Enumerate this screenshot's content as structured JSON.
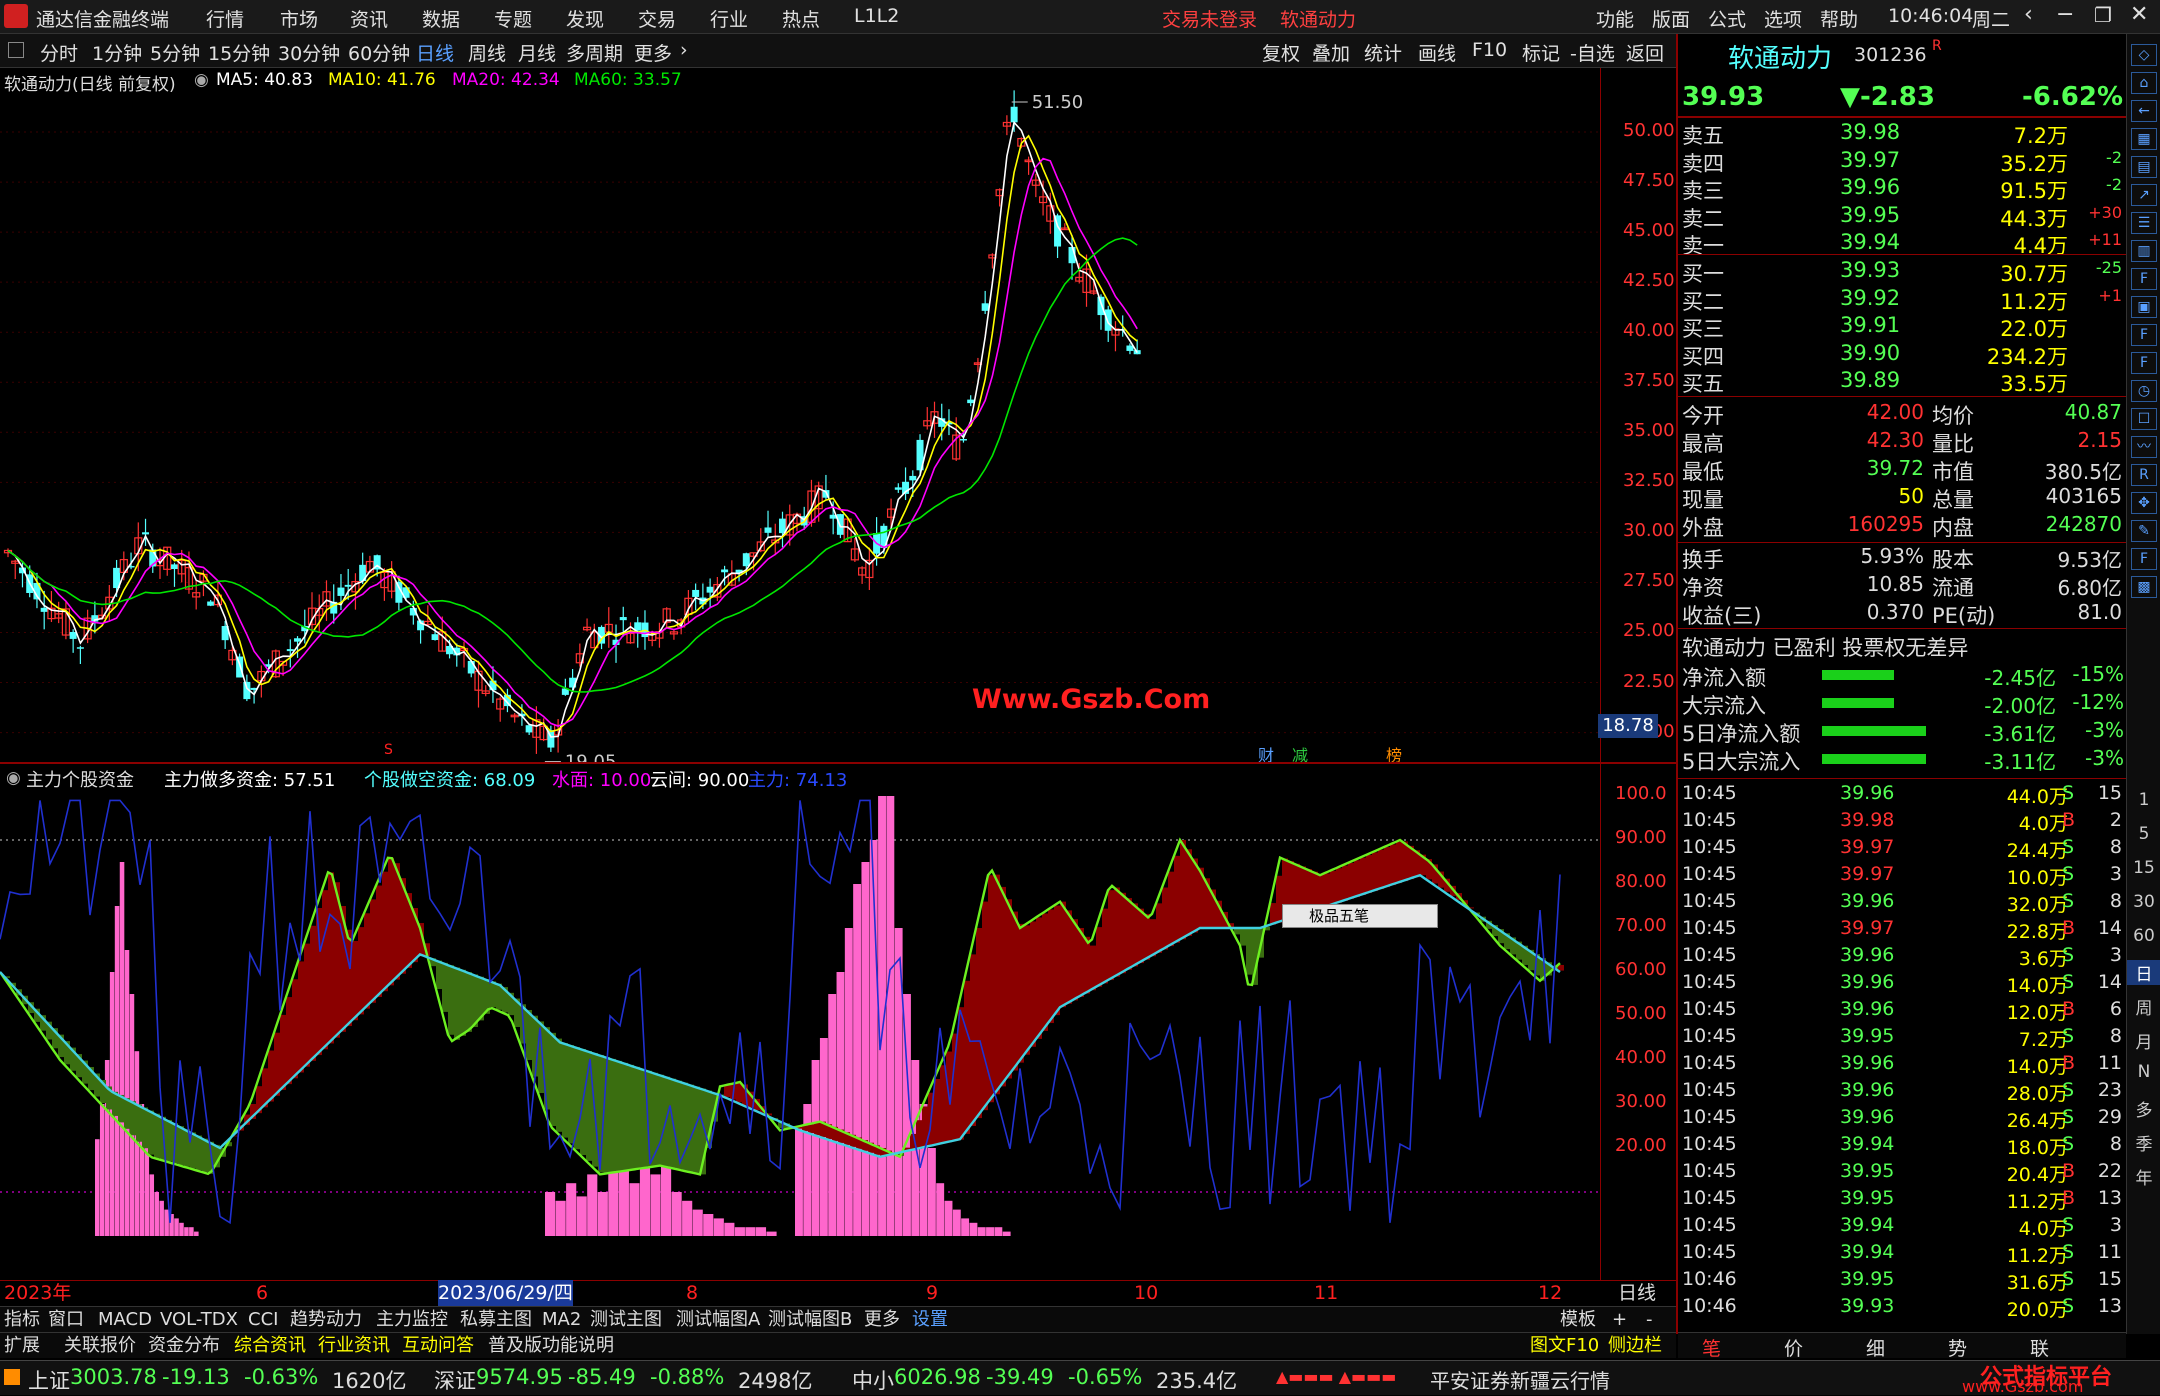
{
  "app": {
    "title": "通达信金融终端",
    "menus": [
      "行情",
      "市场",
      "资讯",
      "数据",
      "专题",
      "发现",
      "交易",
      "行业",
      "热点",
      "L1L2"
    ],
    "login": "交易未登录",
    "stock_title": "软通动力",
    "right_menus": [
      "功能",
      "版面",
      "公式",
      "选项",
      "帮助"
    ],
    "time": "10:46:04",
    "weekday": "周二"
  },
  "periods": {
    "items": [
      "分时",
      "1分钟",
      "5分钟",
      "15分钟",
      "30分钟",
      "60分钟",
      "日线",
      "周线",
      "月线",
      "多周期",
      "更多"
    ],
    "active": "日线",
    "tools": [
      "复权",
      "叠加",
      "统计",
      "画线",
      "F10",
      "标记",
      "-自选",
      "返回"
    ]
  },
  "main_chart": {
    "title": "软通动力(日线 前复权)",
    "ma5": "MA5: 40.83",
    "ma10": "MA10: 41.76",
    "ma20": "MA20: 42.34",
    "ma60": "MA60: 33.57",
    "high_label": "51.50",
    "low_label": "19.05",
    "price_cursor": "18.78",
    "watermark": "Www.Gszb.Com",
    "markers": [
      "财",
      "减",
      "榜"
    ],
    "s_marker": "S",
    "y_ticks": [
      "50.00",
      "47.50",
      "45.00",
      "42.50",
      "40.00",
      "37.50",
      "35.00",
      "32.50",
      "30.00",
      "27.50",
      "25.00",
      "22.50",
      "20.00"
    ]
  },
  "indicator": {
    "title": "主力个股资金",
    "zhuli": "主力做多资金: 57.51",
    "geg": "个股做空资金: 68.09",
    "shuimian": "水面: 10.00",
    "yunjian": "云间: 90.00",
    "zhuli_text": "主力: 74.13",
    "y_ticks": [
      "100.0",
      "90.00",
      "80.00",
      "70.00",
      "60.00",
      "50.00",
      "40.00",
      "30.00",
      "20.00"
    ],
    "popup": "极品五笔"
  },
  "x_axis": {
    "labels": [
      "2023年",
      "6",
      "2023/06/29/四",
      "8",
      "9",
      "10",
      "11",
      "12"
    ],
    "right": "日线"
  },
  "tabs1": [
    "指标",
    "窗口",
    "MACD",
    "VOL-TDX",
    "CCI",
    "趋势动力",
    "主力监控",
    "私募主图",
    "MA2",
    "测试主图",
    "测试幅图A",
    "测试幅图B",
    "更多",
    "设置"
  ],
  "tabs1_right": [
    "模板",
    "+",
    "-"
  ],
  "tabs2": [
    "扩展",
    "关联报价",
    "资金分布",
    "综合资讯",
    "行业资讯",
    "互动问答",
    "普及版功能说明"
  ],
  "tabs2_right": [
    "图文F10",
    "侧边栏"
  ],
  "quote": {
    "name": "软通动力",
    "code": "301236",
    "flag": "R",
    "price": "39.93",
    "change": "▼-2.83",
    "pct": "-6.62%",
    "asks": [
      {
        "l": "卖五",
        "p": "39.98",
        "v": "7.2万",
        "d": ""
      },
      {
        "l": "卖四",
        "p": "39.97",
        "v": "35.2万",
        "d": "-2"
      },
      {
        "l": "卖三",
        "p": "39.96",
        "v": "91.5万",
        "d": "-2"
      },
      {
        "l": "卖二",
        "p": "39.95",
        "v": "44.3万",
        "d": "+30"
      },
      {
        "l": "卖一",
        "p": "39.94",
        "v": "4.4万",
        "d": "+11"
      }
    ],
    "bids": [
      {
        "l": "买一",
        "p": "39.93",
        "v": "30.7万",
        "d": "-25"
      },
      {
        "l": "买二",
        "p": "39.92",
        "v": "11.2万",
        "d": "+1"
      },
      {
        "l": "买三",
        "p": "39.91",
        "v": "22.0万",
        "d": ""
      },
      {
        "l": "买四",
        "p": "39.90",
        "v": "234.2万",
        "d": ""
      },
      {
        "l": "买五",
        "p": "39.89",
        "v": "33.5万",
        "d": ""
      }
    ],
    "stats": [
      [
        "今开",
        "42.00",
        "均价",
        "40.87"
      ],
      [
        "最高",
        "42.30",
        "量比",
        "2.15"
      ],
      [
        "最低",
        "39.72",
        "市值",
        "380.5亿"
      ],
      [
        "现量",
        "50",
        "总量",
        "403165"
      ],
      [
        "外盘",
        "160295",
        "内盘",
        "242870"
      ]
    ],
    "stats2": [
      [
        "换手",
        "5.93%",
        "股本",
        "9.53亿"
      ],
      [
        "净资",
        "10.85",
        "流通",
        "6.80亿"
      ],
      [
        "收益(三)",
        "0.370",
        "PE(动)",
        "81.0"
      ]
    ],
    "tags": "软通动力 已盈利 投票权无差异",
    "flows": [
      [
        "净流入额",
        "-2.45亿",
        "-15%"
      ],
      [
        "大宗流入",
        "-2.00亿",
        "-12%"
      ],
      [
        "5日净流入额",
        "-3.61亿",
        "-3%"
      ],
      [
        "5日大宗流入",
        "-3.11亿",
        "-3%"
      ]
    ]
  },
  "ticks": [
    [
      "10:45",
      "39.96",
      "44.0万",
      "S",
      "15"
    ],
    [
      "10:45",
      "39.98",
      "4.0万",
      "B",
      "2"
    ],
    [
      "10:45",
      "39.97",
      "24.4万",
      "S",
      "8"
    ],
    [
      "10:45",
      "39.97",
      "10.0万",
      "S",
      "3"
    ],
    [
      "10:45",
      "39.96",
      "32.0万",
      "S",
      "8"
    ],
    [
      "10:45",
      "39.97",
      "22.8万",
      "B",
      "14"
    ],
    [
      "10:45",
      "39.96",
      "3.6万",
      "S",
      "3"
    ],
    [
      "10:45",
      "39.96",
      "14.0万",
      "S",
      "14"
    ],
    [
      "10:45",
      "39.96",
      "12.0万",
      "B",
      "6"
    ],
    [
      "10:45",
      "39.95",
      "7.2万",
      "S",
      "8"
    ],
    [
      "10:45",
      "39.96",
      "14.0万",
      "B",
      "11"
    ],
    [
      "10:45",
      "39.96",
      "28.0万",
      "S",
      "23"
    ],
    [
      "10:45",
      "39.96",
      "26.4万",
      "S",
      "29"
    ],
    [
      "10:45",
      "39.94",
      "18.0万",
      "S",
      "8"
    ],
    [
      "10:45",
      "39.95",
      "20.4万",
      "B",
      "22"
    ],
    [
      "10:45",
      "39.95",
      "11.2万",
      "B",
      "13"
    ],
    [
      "10:45",
      "39.94",
      "4.0万",
      "S",
      "3"
    ],
    [
      "10:45",
      "39.94",
      "11.2万",
      "S",
      "11"
    ],
    [
      "10:46",
      "39.95",
      "31.6万",
      "S",
      "15"
    ],
    [
      "10:46",
      "39.93",
      "20.0万",
      "S",
      "13"
    ]
  ],
  "right_tabs": [
    "笔",
    "价",
    "细",
    "势",
    "联"
  ],
  "sidebar_nums": [
    "1",
    "5",
    "15",
    "30",
    "60",
    "日",
    "周",
    "月",
    "N",
    "多",
    "季",
    "年"
  ],
  "status": {
    "sh": [
      "上证",
      "3003.78",
      "-19.13",
      "-0.63%",
      "1620亿"
    ],
    "sz": [
      "深证",
      "9574.95",
      "-85.49",
      "-0.88%",
      "2498亿"
    ],
    "zx": [
      "中小",
      "6026.98",
      "-39.49",
      "-0.65%",
      "235.4亿"
    ],
    "broker": "平安证券新疆云行情",
    "brand": "公式指标平台",
    "brand_url": "www.Gszb.com"
  },
  "colors": {
    "up": "#ff3232",
    "down": "#54ffff",
    "ma5": "#ffffff",
    "ma10": "#ffff00",
    "ma20": "#ff00ff",
    "ma60": "#00e600",
    "volume": "#ff66cc"
  },
  "chart_data": {
    "type": "candlestick",
    "x_start": "2023年",
    "ylim": [
      18.78,
      51.5
    ],
    "marked_high": 51.5,
    "marked_low": 19.05,
    "indicator_ylim": [
      0,
      100
    ],
    "indicator_levels": [
      10,
      90
    ]
  }
}
